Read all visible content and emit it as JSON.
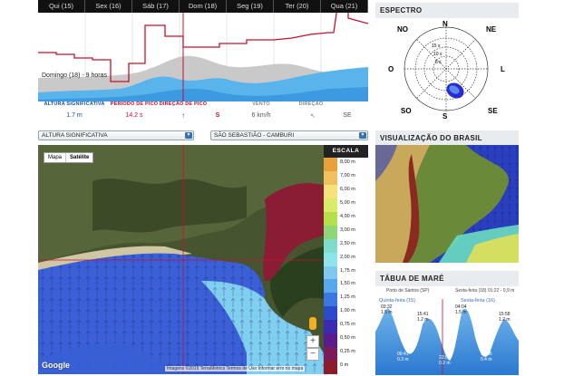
{
  "top_chart": {
    "days": [
      "Qui (15)",
      "Sex (16)",
      "Sáb (17)",
      "Dom (18)",
      "Seg (19)",
      "Ter (20)",
      "Qua (21)"
    ],
    "cursor_label": "Domingo (18) - 9 horas"
  },
  "readout": [
    {
      "label": "ALTURA SIGNIFICATIVA",
      "value": "1.7 m",
      "color": "#1f4fa0"
    },
    {
      "label": "PERÍODO DE PICO",
      "value": "14.2 s",
      "color": "#c8102e"
    },
    {
      "label": "DIREÇÃO DE PICO",
      "value": "↑",
      "color": "#c8102e"
    },
    {
      "label": "",
      "value": "S",
      "color": "#c8102e"
    },
    {
      "label": "VENTO",
      "value": "6 km/h",
      "color": "#888888"
    },
    {
      "label": "DIREÇÃO",
      "value": "↖",
      "color": "#888888"
    },
    {
      "label": "",
      "value": "SE",
      "color": "#888888"
    }
  ],
  "selects": {
    "variable": "ALTURA SIGNIFICATIVA",
    "location": "SÃO SEBASTIÃO - CAMBURI"
  },
  "map": {
    "tabs": [
      "Mapa",
      "Satélite"
    ],
    "active_tab": "Satélite",
    "zoom_in": "+",
    "zoom_out": "−",
    "credit": "Imagens ©2015 TerraMetrics   Termos de Uso   Informar erro no mapa",
    "google": "Google"
  },
  "legend": {
    "title": "ESCALA",
    "rows": [
      {
        "label": "8,00 m",
        "color": "#e8a23a"
      },
      {
        "label": "7,00 m",
        "color": "#f0c060"
      },
      {
        "label": "6,00 m",
        "color": "#f6e27a"
      },
      {
        "label": "5,00 m",
        "color": "#d8ec6a"
      },
      {
        "label": "4,00 m",
        "color": "#b4e04a"
      },
      {
        "label": "3,00 m",
        "color": "#8fd676"
      },
      {
        "label": "2,50 m",
        "color": "#7fdcc8"
      },
      {
        "label": "2,00 m",
        "color": "#8fe4ec"
      },
      {
        "label": "1,75 m",
        "color": "#7fc8f0"
      },
      {
        "label": "1,50 m",
        "color": "#5aa8ec"
      },
      {
        "label": "1,25 m",
        "color": "#3a78e0"
      },
      {
        "label": "1,00 m",
        "color": "#2a4ccc"
      },
      {
        "label": "0,75 m",
        "color": "#3a2cb0"
      },
      {
        "label": "0,50 m",
        "color": "#5a1c8c"
      },
      {
        "label": "0,25 m",
        "color": "#7a1c5a"
      },
      {
        "label": "0 m",
        "color": "#8a1c2c"
      }
    ]
  },
  "spectrum": {
    "title": "ESPECTRO",
    "directions": [
      "N",
      "NE",
      "L",
      "SE",
      "S",
      "SO",
      "O",
      "NO"
    ],
    "rings": [
      "15 s",
      "10 s",
      "5 s"
    ]
  },
  "brasil": {
    "title": "VISUALIZAÇÃO DO BRASIL"
  },
  "tide": {
    "title": "TÁBUA DE MARÉ",
    "port": "Porto de Santos (SP)",
    "now": "Sexta-feira (18) 01:22 - 0,9 m",
    "days": [
      "Quinta-feira (15)",
      "Sexta-feira (16)"
    ],
    "highs": [
      {
        "time": "03:32",
        "h": "1.5 m"
      },
      {
        "time": "15:41",
        "h": "1.2 m"
      },
      {
        "time": "04:04",
        "h": "1.5 m"
      },
      {
        "time": "15:58",
        "h": "1.2 m"
      }
    ],
    "lows": [
      {
        "time": "09:41",
        "h": "0.3 m"
      },
      {
        "time": "22:08",
        "h": "0.2 m"
      },
      {
        "time": "10:06",
        "h": "0.4 m"
      }
    ]
  }
}
